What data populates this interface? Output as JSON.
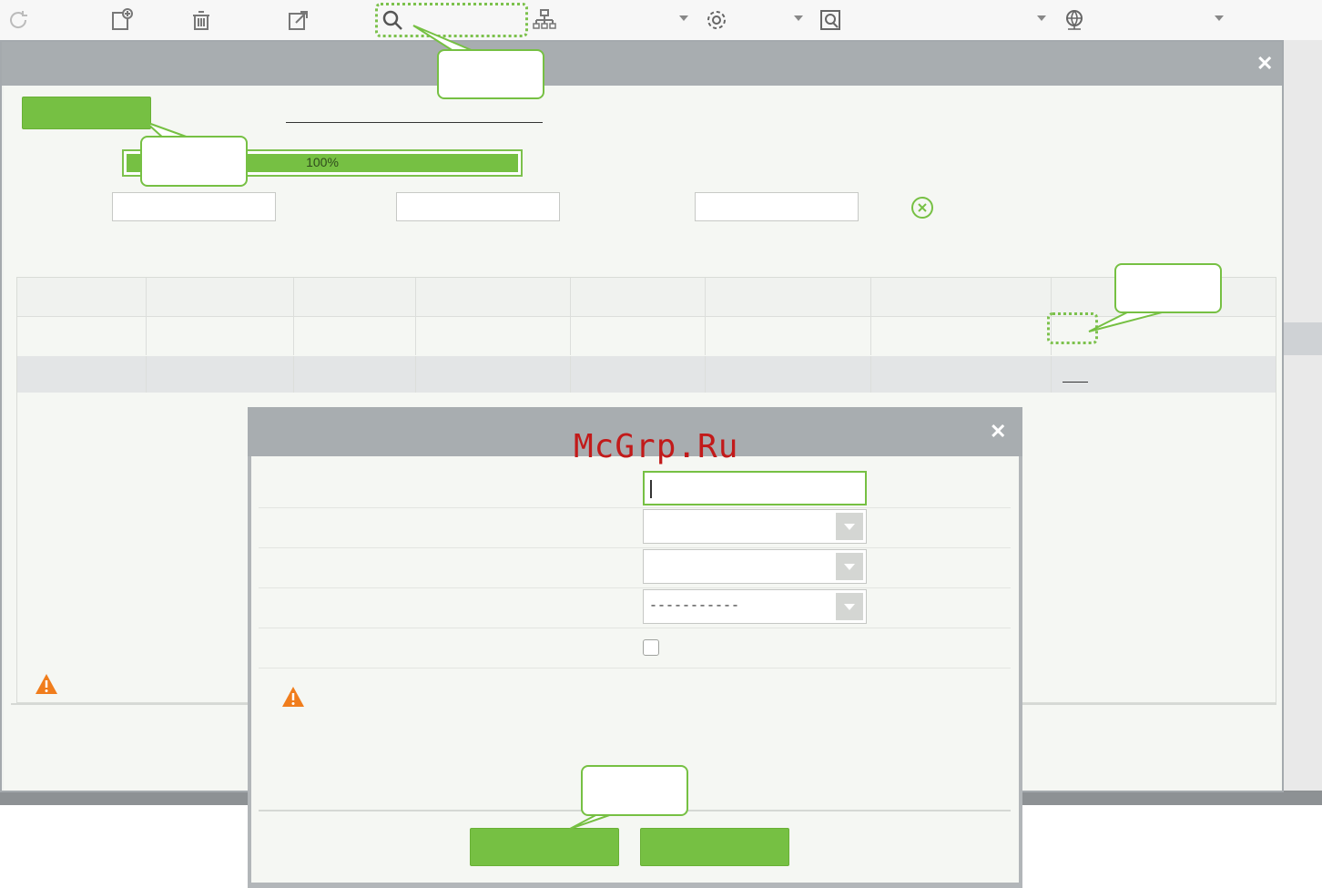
{
  "toolbar": {
    "items": [
      {
        "icon": "refresh-icon"
      },
      {
        "icon": "add-document-icon"
      },
      {
        "icon": "delete-icon"
      },
      {
        "icon": "export-icon"
      },
      {
        "icon": "search-icon"
      },
      {
        "icon": "network-icon"
      },
      {
        "icon": "settings-gear-icon"
      },
      {
        "icon": "search-window-icon"
      },
      {
        "icon": "globe-icon"
      }
    ]
  },
  "main_dialog": {
    "close_glyph": "✕",
    "progress_label": "100%",
    "progress_value": 1.0,
    "clear_icon": "clear-circle-icon"
  },
  "sub_dialog": {
    "close_glyph": "✕",
    "select_3_value": "-----------",
    "checkbox_checked": false
  },
  "watermark": "McGrp.Ru",
  "colors": {
    "accent": "#76c043",
    "header": "#a8adb0",
    "warning": "#f07d1c"
  }
}
